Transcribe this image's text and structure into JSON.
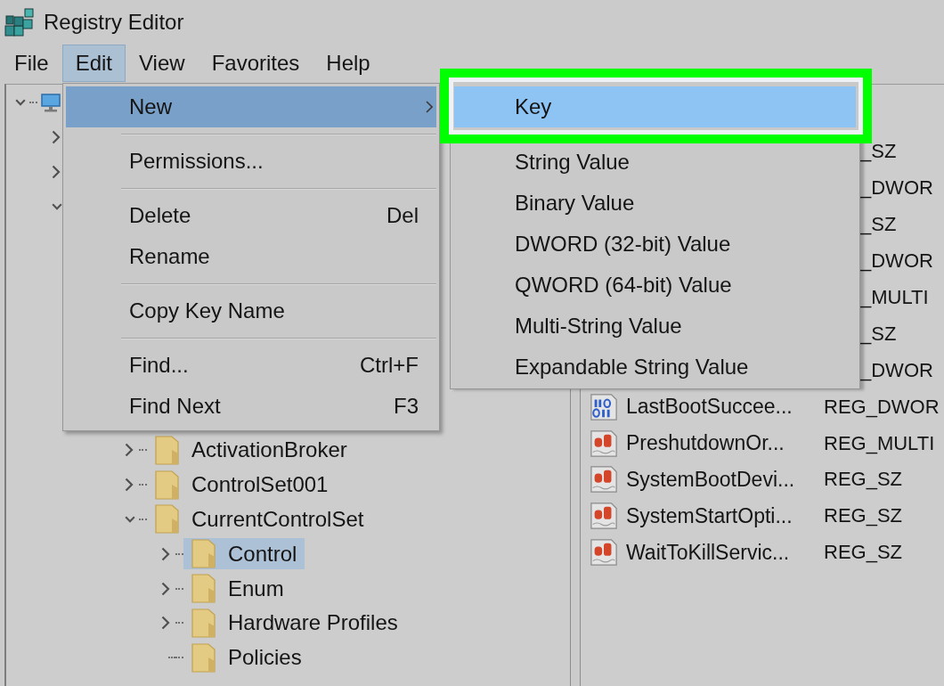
{
  "window": {
    "title": "Registry Editor"
  },
  "menu_bar": [
    {
      "label": "File",
      "selected": false
    },
    {
      "label": "Edit",
      "selected": true
    },
    {
      "label": "View",
      "selected": false
    },
    {
      "label": "Favorites",
      "selected": false
    },
    {
      "label": "Help",
      "selected": false
    }
  ],
  "edit_menu": {
    "items": [
      {
        "kind": "item",
        "label": "New",
        "has_submenu": true,
        "selected": true
      },
      {
        "kind": "separator"
      },
      {
        "kind": "item",
        "label": "Permissions...",
        "has_submenu": false,
        "selected": false
      },
      {
        "kind": "separator"
      },
      {
        "kind": "item",
        "label": "Delete",
        "shortcut": "Del",
        "has_submenu": false,
        "selected": false
      },
      {
        "kind": "item",
        "label": "Rename",
        "has_submenu": false,
        "selected": false
      },
      {
        "kind": "separator"
      },
      {
        "kind": "item",
        "label": "Copy Key Name",
        "has_submenu": false,
        "selected": false
      },
      {
        "kind": "separator"
      },
      {
        "kind": "item",
        "label": "Find...",
        "shortcut": "Ctrl+F",
        "has_submenu": false,
        "selected": false
      },
      {
        "kind": "item",
        "label": "Find Next",
        "shortcut": "F3",
        "has_submenu": false,
        "selected": false
      }
    ]
  },
  "new_submenu": {
    "items": [
      {
        "label": "Key",
        "selected": true,
        "outlined": true
      },
      {
        "label": "String Value",
        "selected": false,
        "outlined": false
      },
      {
        "label": "Binary Value",
        "selected": false,
        "outlined": false
      },
      {
        "label": "DWORD (32-bit) Value",
        "selected": false,
        "outlined": false
      },
      {
        "label": "QWORD (64-bit) Value",
        "selected": false,
        "outlined": false
      },
      {
        "label": "Multi-String Value",
        "selected": false,
        "outlined": false
      },
      {
        "label": "Expandable String Value",
        "selected": false,
        "outlined": false
      }
    ]
  },
  "tree": {
    "items": [
      {
        "kind": "computer",
        "expanded": true,
        "children": [
          {
            "expanded": false
          },
          {
            "expanded": false
          },
          {
            "expanded": true
          }
        ]
      }
    ],
    "lower_items": [
      {
        "kind": "folder",
        "label": "ActivationBroker",
        "expanded": false,
        "selected": false
      },
      {
        "kind": "folder",
        "label": "ControlSet001",
        "expanded": false,
        "selected": false
      },
      {
        "kind": "folder",
        "label": "CurrentControlSet",
        "expanded": true,
        "selected": false,
        "children": [
          {
            "kind": "folder",
            "label": "Control",
            "expanded": false,
            "selected": true
          },
          {
            "kind": "folder",
            "label": "Enum",
            "expanded": false,
            "selected": false
          },
          {
            "kind": "folder",
            "label": "Hardware Profiles",
            "expanded": false,
            "selected": false
          },
          {
            "kind": "folder",
            "label": "Policies",
            "selected": false
          }
        ]
      }
    ]
  },
  "values_list": {
    "rows": [
      {
        "type": "_SZ"
      },
      {
        "type": "_DWOR"
      },
      {
        "type": "_SZ"
      },
      {
        "type": "_DWOR"
      },
      {
        "type": "_MULTI"
      },
      {
        "type": "_SZ"
      },
      {
        "type": "_DWOR"
      },
      {
        "kind": "binary",
        "name": "LastBootSuccee...",
        "type": "REG_DWOR"
      },
      {
        "kind": "string",
        "name": "PreshutdownOr...",
        "type": "REG_MULTI"
      },
      {
        "kind": "string",
        "name": "SystemBootDevi...",
        "type": "REG_SZ"
      },
      {
        "kind": "string",
        "name": "SystemStartOpti...",
        "type": "REG_SZ"
      },
      {
        "kind": "string",
        "name": "WaitToKillServic...",
        "type": "REG_SZ"
      }
    ]
  }
}
